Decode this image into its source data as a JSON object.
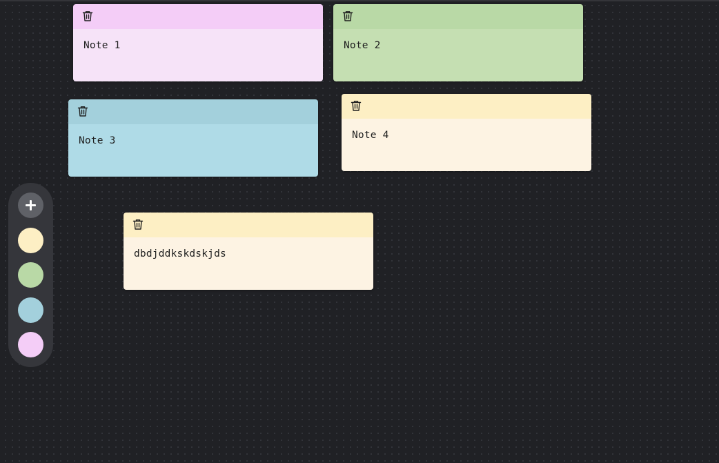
{
  "notes": [
    {
      "text": "Note 1",
      "header_color": "#f4cdf7",
      "body_color": "#f6e3f8"
    },
    {
      "text": "Note 2",
      "header_color": "#b9d9a6",
      "body_color": "#c5dfb2"
    },
    {
      "text": "Note 3",
      "header_color": "#a3d0dc",
      "body_color": "#afdbe7"
    },
    {
      "text": "Note 4",
      "header_color": "#fdefc4",
      "body_color": "#fdf3e3"
    },
    {
      "text": "dbdjddkskdskjds",
      "header_color": "#fdefc4",
      "body_color": "#fdf3e3"
    }
  ],
  "note_icon": "trash-icon",
  "toolbar": {
    "add_icon": "plus-icon",
    "background": "#35363b",
    "swatches": [
      {
        "color": "#fdefc4"
      },
      {
        "color": "#b9d9a6"
      },
      {
        "color": "#a3d0dc"
      },
      {
        "color": "#f4cdf7"
      }
    ]
  },
  "canvas": {
    "background": "#202125",
    "dot_color": "#34363c"
  }
}
